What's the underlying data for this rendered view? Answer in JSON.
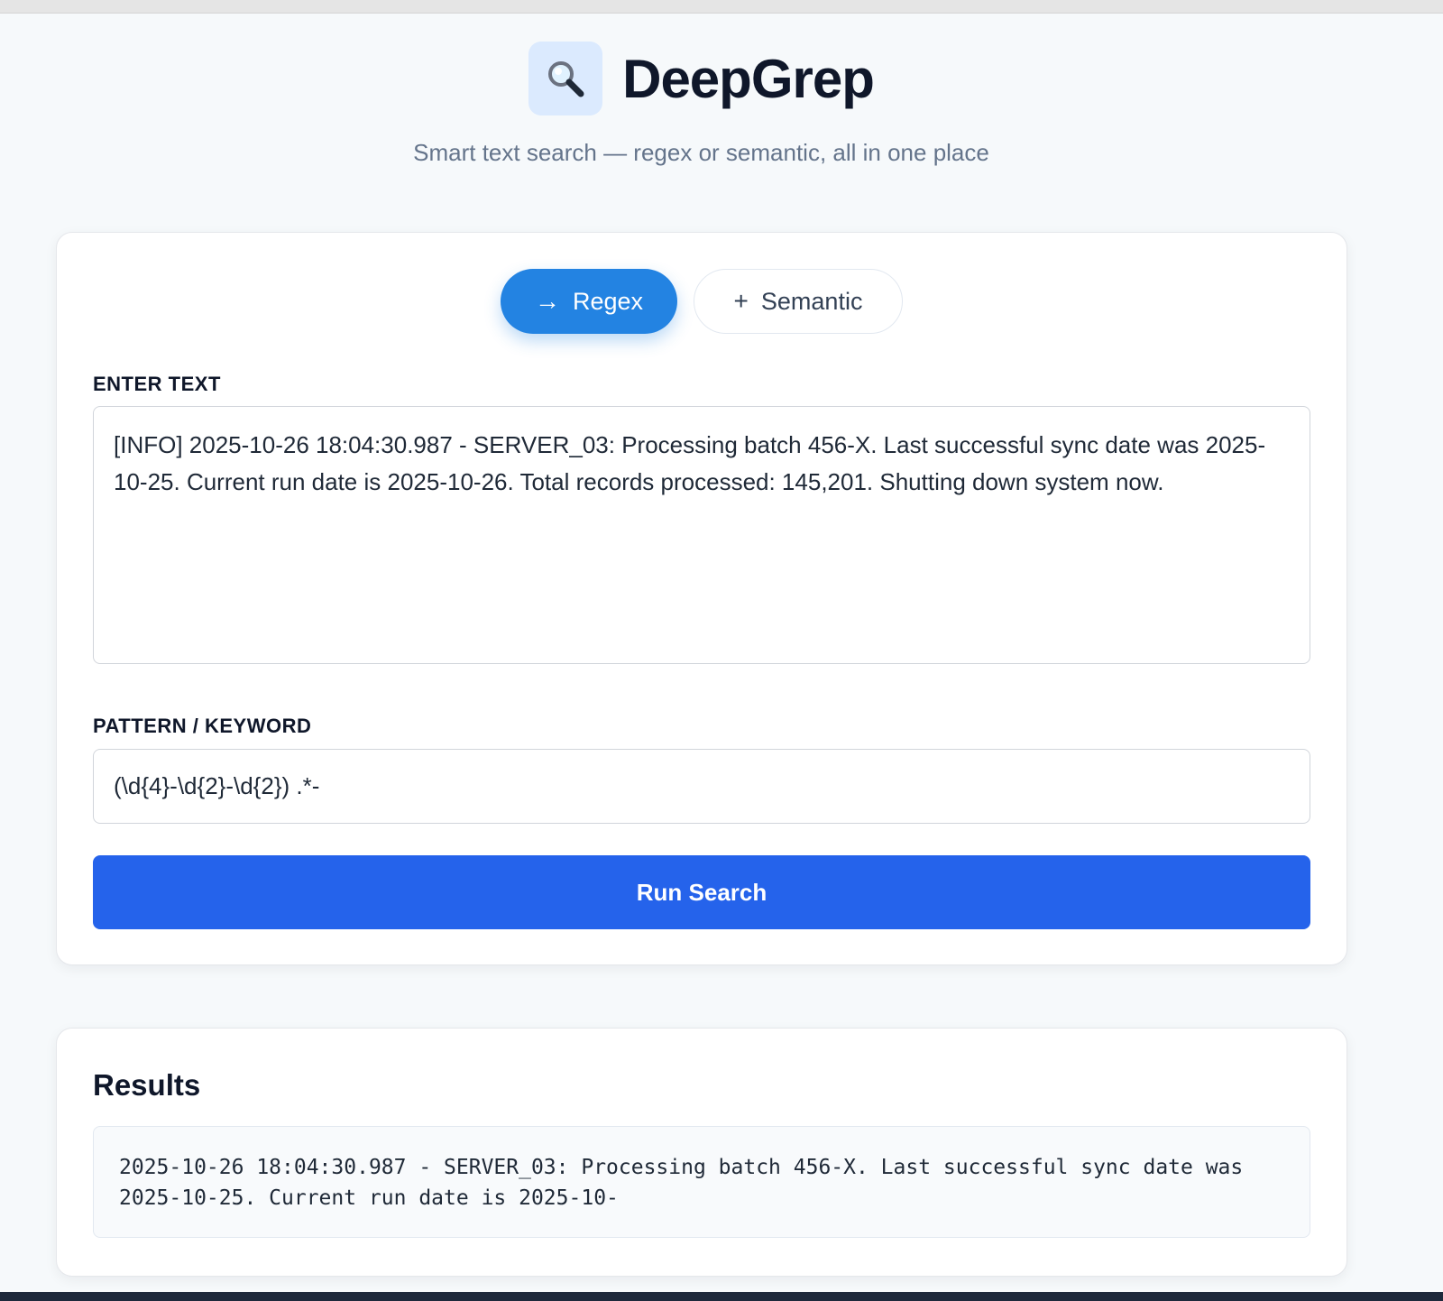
{
  "app": {
    "title": "DeepGrep",
    "subtitle": "Smart text search — regex or semantic, all in one place",
    "logo_icon": "magnifying-glass-icon"
  },
  "mode_toggle": {
    "regex": {
      "label": "Regex",
      "icon": "→",
      "icon_name": "arrow-right-icon",
      "active": true
    },
    "semantic": {
      "label": "Semantic",
      "icon": "+",
      "icon_name": "plus-icon",
      "active": false
    }
  },
  "input": {
    "label": "ENTER TEXT",
    "value": "[INFO] 2025-10-26 18:04:30.987 - SERVER_03: Processing batch 456-X. Last successful sync date was 2025-10-25. Current run date is 2025-10-26. Total records processed: 145,201. Shutting down system now."
  },
  "pattern": {
    "label": "PATTERN / KEYWORD",
    "value": "(\\d{4}-\\d{2}-\\d{2}) .*-"
  },
  "run_button": {
    "label": "Run Search"
  },
  "results": {
    "title": "Results",
    "output": "2025-10-26 18:04:30.987 - SERVER_03: Processing batch 456-X. Last successful sync date was 2025-10-25. Current run date is 2025-10-"
  },
  "colors": {
    "accent": "#2383e2",
    "run_button": "#2563eb",
    "logo_bg": "#dbeafe",
    "page_bg": "#f6f9fb"
  }
}
